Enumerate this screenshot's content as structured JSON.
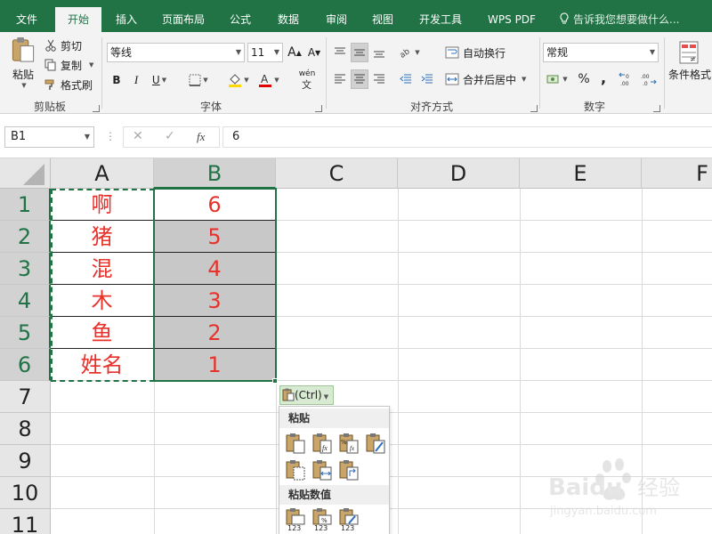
{
  "menu": {
    "tabs": [
      "文件",
      "开始",
      "插入",
      "页面布局",
      "公式",
      "数据",
      "审阅",
      "视图",
      "开发工具",
      "WPS PDF"
    ],
    "active_index": 1,
    "tell_me": "告诉我您想要做什么..."
  },
  "ribbon": {
    "clipboard": {
      "paste": "粘贴",
      "cut": "剪切",
      "copy": "复制",
      "format_painter": "格式刷",
      "label": "剪贴板"
    },
    "font": {
      "name": "等线",
      "size": "11",
      "bold": "B",
      "italic": "I",
      "underline": "U",
      "grow": "A",
      "shrink": "A",
      "phonetic": "wén",
      "label": "字体"
    },
    "alignment": {
      "wrap": "自动换行",
      "merge": "合并后居中",
      "label": "对齐方式"
    },
    "number": {
      "format": "常规",
      "percent": "%",
      "comma": ",",
      "label": "数字"
    },
    "styles": {
      "conditional": "条件格式"
    }
  },
  "formula_bar": {
    "name_box": "B1",
    "fx": "fx",
    "value": "6"
  },
  "grid": {
    "columns": [
      "A",
      "B",
      "C",
      "D",
      "E",
      "F"
    ],
    "rows": [
      "1",
      "2",
      "3",
      "4",
      "5",
      "6",
      "7",
      "8",
      "9",
      "10",
      "11"
    ],
    "col_a": [
      "啊",
      "猪",
      "混",
      "木",
      "鱼",
      "姓名"
    ],
    "col_b": [
      "6",
      "5",
      "4",
      "3",
      "2",
      "1"
    ]
  },
  "paste_popup": {
    "button": "(Ctrl)",
    "section_paste": "粘贴",
    "section_values": "粘贴数值",
    "icon_digits": "123",
    "icon_pct": "%",
    "icon_fx": "fx"
  },
  "watermark": {
    "brand": "Baidu",
    "sub": "经验",
    "url": "jingyan.baidu.com"
  },
  "colors": {
    "accent": "#217346",
    "cell_text": "#e8312a",
    "shade": "#c8c8c8"
  }
}
